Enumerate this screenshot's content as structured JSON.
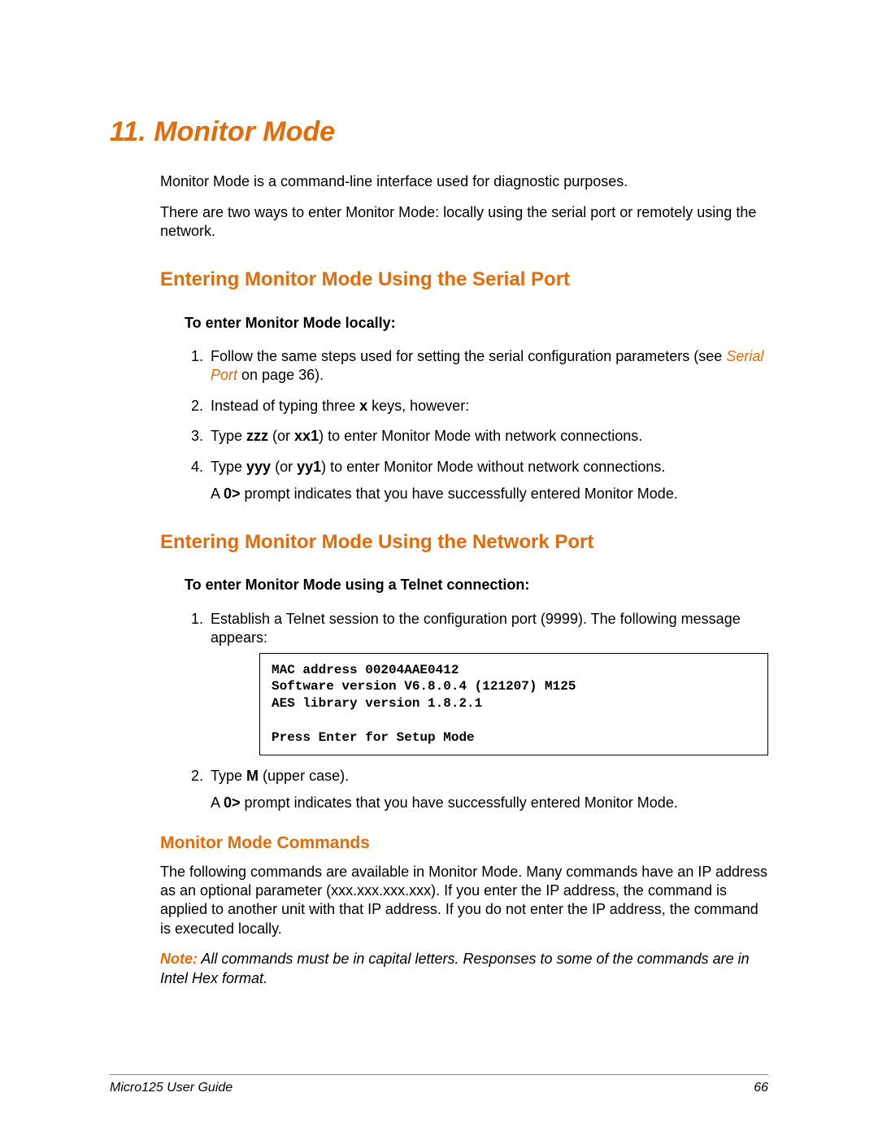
{
  "chapter": {
    "number": "11.",
    "title": "Monitor Mode"
  },
  "intro": {
    "p1": "Monitor Mode is a command-line interface used for diagnostic purposes.",
    "p2": "There are two ways to enter Monitor Mode: locally using the serial port or remotely using the network."
  },
  "section_serial": {
    "heading": "Entering Monitor Mode Using the Serial Port",
    "lead": "To enter Monitor Mode locally:",
    "step1_a": "Follow the same steps used for setting the serial configuration parameters (see ",
    "step1_link": "Serial Port",
    "step1_b": " on page 36).",
    "step2_a": "Instead of typing three ",
    "step2_x": "x",
    "step2_b": " keys, however:",
    "step3_a": "Type ",
    "step3_zzz": "zzz",
    "step3_or": " (or ",
    "step3_xx1": "xx1",
    "step3_b": ") to enter Monitor Mode with network connections.",
    "step4_a": "Type ",
    "step4_yyy": "yyy",
    "step4_or": " (or ",
    "step4_yy1": "yy1",
    "step4_b": ") to enter Monitor Mode without network connections.",
    "step4_cont_a": "A ",
    "step4_cont_prompt": "0>",
    "step4_cont_b": " prompt indicates that you have successfully entered Monitor Mode."
  },
  "section_network": {
    "heading": "Entering Monitor Mode Using the Network Port",
    "lead": "To enter Monitor Mode using a Telnet connection:",
    "step1": "Establish a Telnet session to the configuration port (9999). The following message appears:",
    "code": "MAC address 00204AAE0412\nSoftware version V6.8.0.4 (121207) M125\nAES library version 1.8.2.1\n\nPress Enter for Setup Mode",
    "step2_a": "Type ",
    "step2_M": "M",
    "step2_b": " (upper case).",
    "step2_cont_a": "A ",
    "step2_cont_prompt": "0>",
    "step2_cont_b": " prompt indicates that you have successfully entered Monitor Mode."
  },
  "subsection_commands": {
    "heading": "Monitor Mode Commands",
    "body": "The following commands are available in Monitor Mode. Many commands have an IP address as an optional parameter (xxx.xxx.xxx.xxx). If you enter the IP address, the command is applied to another unit with that IP address. If you do not enter the IP address, the command is executed locally.",
    "note_label": "Note:",
    "note_text": " All commands must be in capital letters. Responses to some of the commands are in Intel Hex format."
  },
  "footer": {
    "left": "Micro125 User Guide",
    "right": "66"
  }
}
